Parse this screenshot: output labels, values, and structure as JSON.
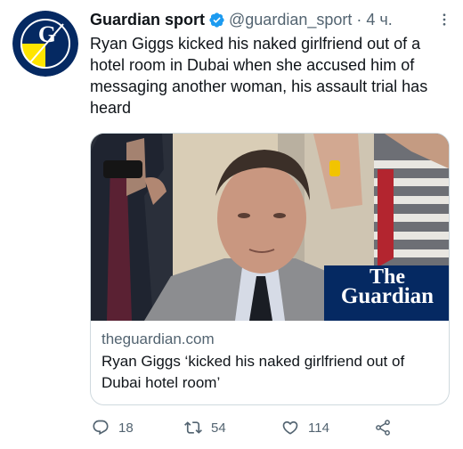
{
  "tweet": {
    "author_name": "Guardian sport",
    "handle": "@guardian_sport",
    "separator": "·",
    "time": "4 ч.",
    "text": "Ryan Giggs kicked his naked girlfriend out of a hotel room in Dubai when she accused him of messaging another woman, his assault trial has heard"
  },
  "avatar": {
    "letter": "G"
  },
  "card": {
    "logo_line1": "The",
    "logo_line2": "Guardian",
    "domain": "theguardian.com",
    "title": "Ryan Giggs ‘kicked his naked girlfriend out of Dubai hotel room’"
  },
  "actions": {
    "replies": "18",
    "retweets": "54",
    "likes": "114"
  },
  "colors": {
    "guardian_navy": "#052962",
    "guardian_yellow": "#ffe500",
    "verified_blue": "#1d9bf0",
    "secondary_text": "#536471"
  },
  "icons": [
    "verified-icon",
    "more-icon",
    "reply-icon",
    "retweet-icon",
    "like-icon",
    "share-icon"
  ]
}
